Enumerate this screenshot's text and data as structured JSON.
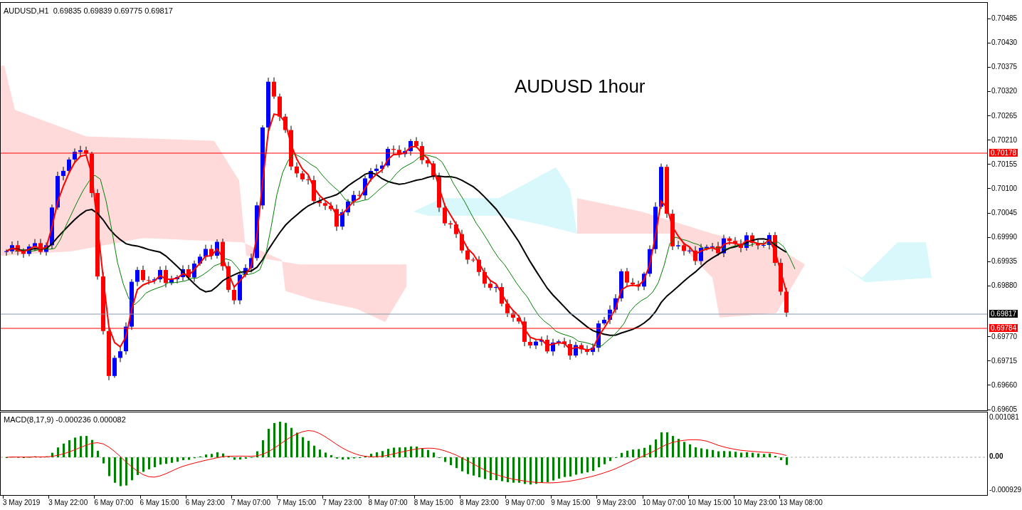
{
  "chart_header": "AUDUSD,H1  0.69835 0.69839 0.69775 0.69817",
  "chart_title": "AUDUSD 1hour",
  "price_axis": [
    "0.70485",
    "0.70430",
    "0.70375",
    "0.70320",
    "0.70265",
    "0.70210",
    "0.70155",
    "0.70100",
    "0.70045",
    "0.69990",
    "0.69935",
    "0.69880",
    "0.69770",
    "0.69715",
    "0.69660",
    "0.69605"
  ],
  "price_markers": [
    {
      "label": "0.70178",
      "color": "#ff0000"
    },
    {
      "label": "0.69817",
      "color": "#000000"
    },
    {
      "label": "0.69784",
      "color": "#ff0000"
    }
  ],
  "macd_header": "MACD(8,17,9) -0.000236 0.000082",
  "macd_axis": [
    "0.001081",
    "0.00",
    "-0.000929"
  ],
  "time_axis": [
    "3 May 2019",
    "3 May 22:00",
    "6 May 07:00",
    "6 May 15:00",
    "6 May 23:00",
    "7 May 07:00",
    "7 May 15:00",
    "7 May 23:00",
    "8 May 07:00",
    "8 May 15:00",
    "8 May 23:00",
    "9 May 07:00",
    "9 May 15:00",
    "9 May 23:00",
    "10 May 07:00",
    "10 May 15:00",
    "10 May 23:00",
    "13 May 08:00"
  ]
}
